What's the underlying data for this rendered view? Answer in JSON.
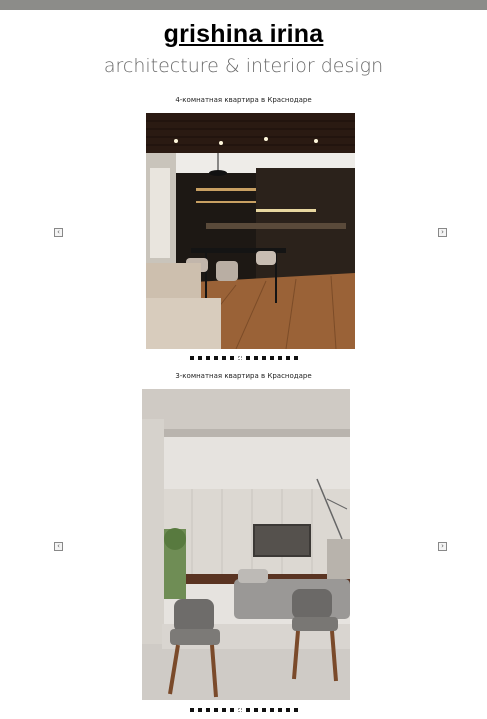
{
  "header": {
    "title": "grishina irina",
    "subtitle": "architecture & interior design"
  },
  "projects": [
    {
      "caption": "4-комнатная квартира в Краснодаре",
      "photo_alt": "kitchen-dining interior",
      "dots": 14,
      "active_dot": 6
    },
    {
      "caption": "3-комнатная квартира в Краснодаре",
      "photo_alt": "living room interior",
      "dots": 14,
      "active_dot": 6
    }
  ],
  "nav": {
    "prev_glyph": "‹",
    "next_glyph": "›"
  },
  "colors": {
    "topbar": "#8c8c89",
    "title": "#000000",
    "subtitle": "#6a6a6a"
  }
}
